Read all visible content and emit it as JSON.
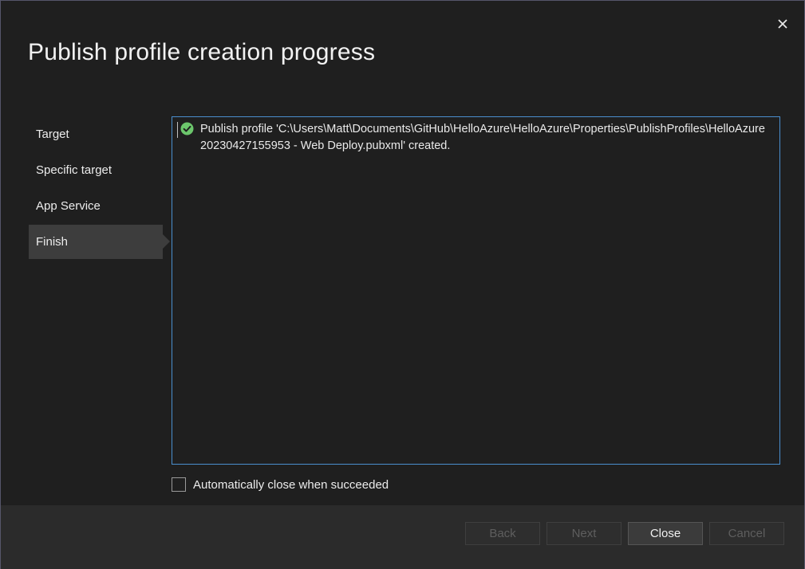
{
  "dialog": {
    "title": "Publish profile creation progress",
    "close_icon": "close-icon"
  },
  "steps": [
    {
      "label": "Target",
      "active": false
    },
    {
      "label": "Specific target",
      "active": false
    },
    {
      "label": "App Service",
      "active": false
    },
    {
      "label": "Finish",
      "active": true
    }
  ],
  "log": {
    "entries": [
      {
        "icon": "success-check-icon",
        "status_color": "#6cc66c",
        "text": "Publish profile 'C:\\Users\\Matt\\Documents\\GitHub\\HelloAzure\\HelloAzure\\Properties\\PublishProfiles\\HelloAzure20230427155953 - Web Deploy.pubxml' created."
      }
    ]
  },
  "auto_close": {
    "label": "Automatically close when succeeded",
    "checked": false
  },
  "buttons": {
    "back": "Back",
    "next": "Next",
    "close": "Close",
    "cancel": "Cancel"
  },
  "colors": {
    "accent_border": "#4a8fcf",
    "background": "#1f1f1f",
    "footer": "#2b2b2b"
  }
}
